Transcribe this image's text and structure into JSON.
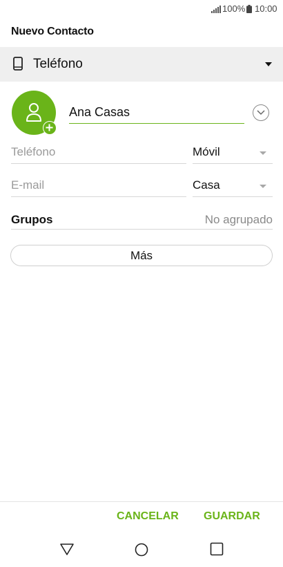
{
  "status_bar": {
    "battery": "100%",
    "time": "10:00",
    "icons": [
      "signal-icon",
      "battery-icon"
    ]
  },
  "header": {
    "title": "Nuevo Contacto"
  },
  "account": {
    "label": "Teléfono",
    "icon": "phone-icon"
  },
  "contact": {
    "name": "Ana Casas",
    "avatar_icon": "person-icon",
    "add_photo_icon": "add-icon",
    "expand_icon": "chevron-down-icon"
  },
  "fields": {
    "phone": {
      "placeholder": "Teléfono",
      "type": "Móvil"
    },
    "email": {
      "placeholder": "E-mail",
      "type": "Casa"
    },
    "groups": {
      "label": "Grupos",
      "value": "No agrupado"
    }
  },
  "more_button": "Más",
  "actions": {
    "cancel": "CANCELAR",
    "save": "GUARDAR"
  },
  "nav": {
    "icons": [
      "back-icon",
      "home-icon",
      "recents-icon"
    ]
  },
  "colors": {
    "accent": "#6ab419",
    "selector_background": "#efefef",
    "divider": "#d6d6d6",
    "placeholder_text": "#9a9a9a"
  }
}
